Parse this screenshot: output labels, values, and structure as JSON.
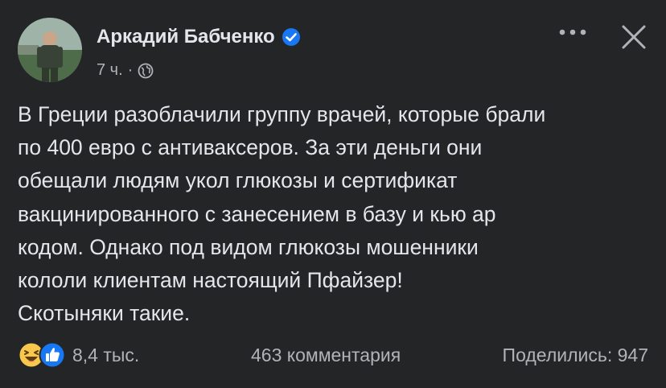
{
  "post": {
    "author": "Аркадий Бабченко",
    "verified": true,
    "time": "7 ч.",
    "separator": "·",
    "audience_icon": "globe-icon",
    "menu_icon": "more-icon",
    "close_icon": "close-icon",
    "text_lines": [
      "В Греции разоблачили группу врачей, которые брали",
      "по 400 евро с антиваксеров. За эти деньги они",
      "обещали людям укол глюкозы и сертификат",
      "вакцинированного с занесением в базу и кью ар",
      "кодом. Однако под видом глюкозы мошенники",
      "кололи клиентам настоящий Пфайзер!",
      "Скотыняки такие."
    ]
  },
  "stats": {
    "reactions": [
      "haha-icon",
      "like-icon"
    ],
    "reaction_count": "8,4 тыс.",
    "comments": "463 комментария",
    "shares": "Поделились: 947"
  },
  "colors": {
    "background": "#242526",
    "text": "#e4e6eb",
    "secondary": "#b0b3b8",
    "accent": "#1877f2"
  }
}
